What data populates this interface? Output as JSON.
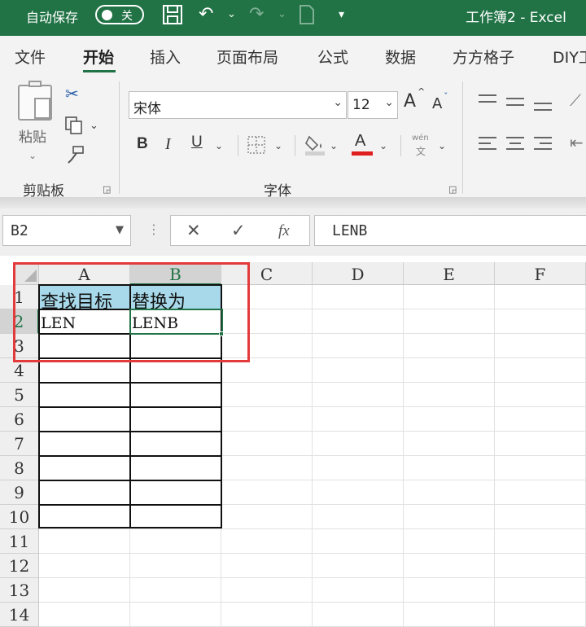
{
  "titlebar": {
    "autosave_label": "自动保存",
    "autosave_state": "关",
    "document_title": "工作簿2  -  Excel"
  },
  "tabs": [
    "文件",
    "开始",
    "插入",
    "页面布局",
    "公式",
    "数据",
    "方方格子",
    "DIY工"
  ],
  "active_tab": "开始",
  "ribbon": {
    "clipboard": {
      "paste_label": "粘贴",
      "group_label": "剪贴板"
    },
    "font": {
      "font_name": "宋体",
      "font_size": "12",
      "grow_label": "A",
      "shrink_label": "A",
      "bold": "B",
      "italic": "I",
      "underline": "U",
      "font_color_label": "A",
      "phonetic_label": "wén",
      "phonetic_sub": "文",
      "group_label": "字体"
    }
  },
  "formula_bar": {
    "name_box": "B2",
    "cancel": "✕",
    "enter": "✓",
    "fx": "fx",
    "content": "LENB"
  },
  "sheet": {
    "columns": [
      "A",
      "B",
      "C",
      "D",
      "E",
      "F"
    ],
    "rows": [
      "1",
      "2",
      "3",
      "4",
      "5",
      "6",
      "7",
      "8",
      "9",
      "10",
      "11",
      "12",
      "13",
      "14"
    ],
    "selected_column": "B",
    "selected_row": "2",
    "cells": {
      "A1": "查找目标",
      "B1": "替换为",
      "A2": "LEN",
      "B2": "LENB"
    }
  },
  "colors": {
    "accent": "#217346",
    "header_fill": "#a8d9ea",
    "highlight_box": "#e33b3b",
    "font_color_bar": "#e02020"
  }
}
